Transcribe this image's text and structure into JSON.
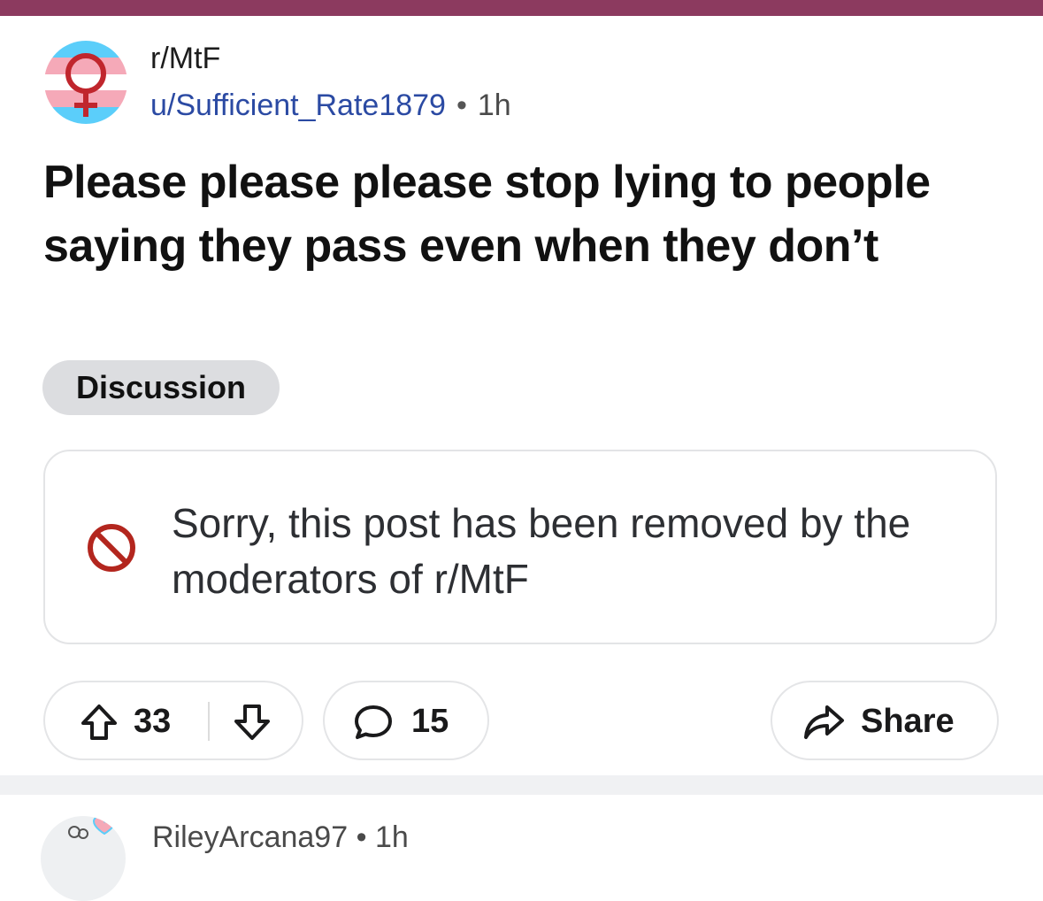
{
  "post": {
    "subreddit": "r/MtF",
    "author": "u/Sufficient_Rate1879",
    "separator": "•",
    "time": "1h",
    "title": "Please please please stop lying to people saying they pass even when they don’t",
    "flair": "Discussion",
    "removed_message": "Sorry, this post has been removed by the moderators of r/MtF"
  },
  "actions": {
    "upvote_icon": "arrow-up-icon",
    "vote_count": "33",
    "downvote_icon": "arrow-down-icon",
    "comment_icon": "comment-bubble-icon",
    "comment_count": "15",
    "share_icon": "share-arrow-icon",
    "share_label": "Share"
  },
  "next_comment": {
    "author": "RileyArcana97",
    "separator": "•",
    "time": "1h"
  },
  "colors": {
    "top_bar": "#8c3a5f",
    "username": "#2b4aa3",
    "removed_icon": "#b3261e",
    "trans_blue": "#5bcefa",
    "trans_pink": "#f5a9b8"
  }
}
